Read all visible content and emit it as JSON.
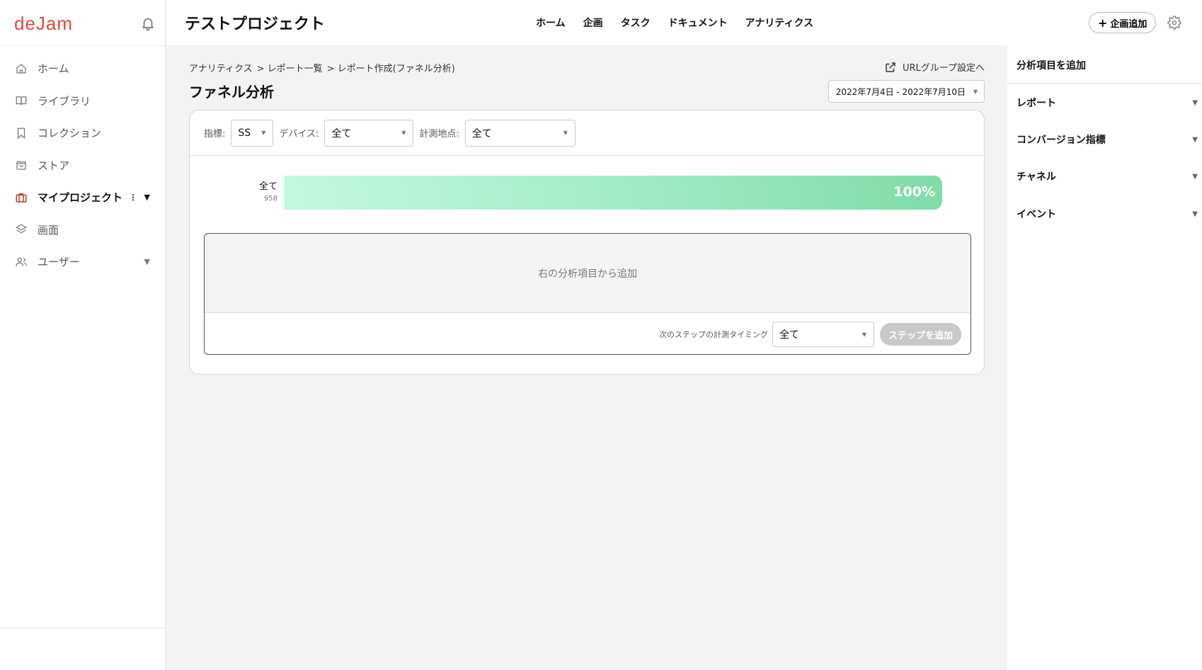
{
  "app": {
    "logo": "deJam"
  },
  "sidebar": {
    "items": [
      {
        "label": "ホーム",
        "icon": "home-icon"
      },
      {
        "label": "ライブラリ",
        "icon": "book-icon"
      },
      {
        "label": "コレクション",
        "icon": "bookmark-icon"
      },
      {
        "label": "ストア",
        "icon": "bag-icon"
      },
      {
        "label": "マイプロジェクト",
        "icon": "briefcase-icon",
        "active": true
      },
      {
        "label": "画面",
        "icon": "layers-icon"
      },
      {
        "label": "ユーザー",
        "icon": "users-icon"
      }
    ]
  },
  "header": {
    "project_title": "テストプロジェクト",
    "nav": [
      "ホーム",
      "企画",
      "タスク",
      "ドキュメント",
      "アナリティクス"
    ],
    "add_plan_label": "企画追加",
    "add_plan_plus": "+"
  },
  "main": {
    "breadcrumb": [
      "アナリティクス",
      "> レポート一覧",
      "> レポート作成(ファネル分析)"
    ],
    "title": "ファネル分析",
    "url_group_label": "URLグループ設定へ",
    "date_range": "2022年7月4日 - 2022年7月10日",
    "filters": {
      "metric_label": "指標:",
      "metric_value": "SS",
      "device_label": "デバイス:",
      "device_value": "全て",
      "point_label": "計測地点:",
      "point_value": "全て"
    },
    "funnel": {
      "label": "全て",
      "count": "958",
      "percent_text": "100%",
      "percent": 100
    },
    "dropzone_text": "右の分析項目から追加",
    "timing_label": "次のステップの計測タイミング",
    "timing_value": "全て",
    "add_step_label": "ステップを追加"
  },
  "right_panel": {
    "title": "分析項目を追加",
    "sections": [
      "レポート",
      "コンバージョン指標",
      "チャネル",
      "イベント"
    ]
  },
  "colors": {
    "brand": "#e0473c",
    "funnel_start": "#c4f9df",
    "funnel_end": "#7fdca7"
  }
}
